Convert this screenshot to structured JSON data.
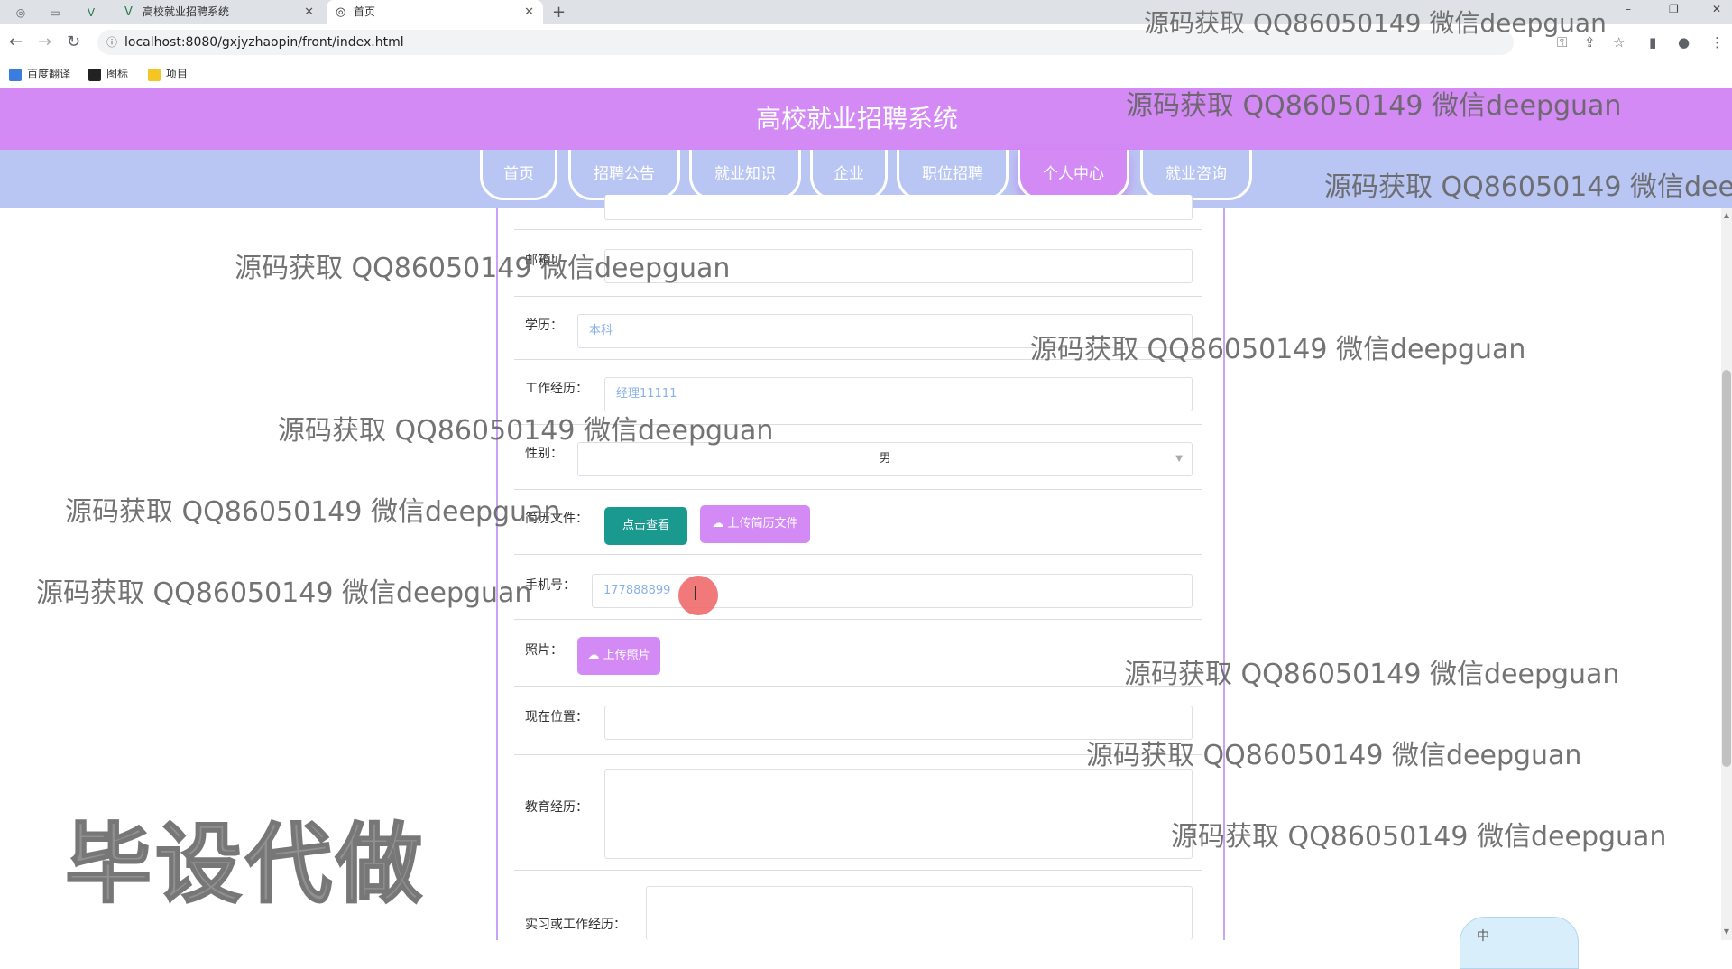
{
  "browser": {
    "tabs": [
      {
        "title": "高校就业招聘系统"
      },
      {
        "title": "首页"
      }
    ],
    "url": "localhost:8080/gxjyzhaopin/front/index.html",
    "bookmarks": [
      "百度翻译",
      "图标",
      "项目"
    ]
  },
  "site": {
    "title": "高校就业招聘系统",
    "nav": [
      "首页",
      "招聘公告",
      "就业知识",
      "企业",
      "职位招聘",
      "个人中心",
      "就业咨询"
    ],
    "active_nav": "个人中心"
  },
  "form": {
    "email_label": "邮箱：",
    "education_label": "学历：",
    "education_value": "本科",
    "work_exp_label": "工作经历：",
    "work_exp_value": "经理11111",
    "gender_label": "性别：",
    "gender_value": "男",
    "resume_label": "简历文件：",
    "view_button": "点击查看",
    "upload_resume_button": "上传简历文件",
    "phone_label": "手机号：",
    "phone_value": "177888899",
    "photo_label": "照片：",
    "upload_photo_button": "上传照片",
    "location_label": "现在位置：",
    "edu_history_label": "教育经历：",
    "intern_label": "实习或工作经历："
  },
  "overlays": {
    "watermark": "源码获取 QQ86050149 微信deepguan",
    "big_watermark": "毕设代做",
    "ime_label": "中"
  }
}
